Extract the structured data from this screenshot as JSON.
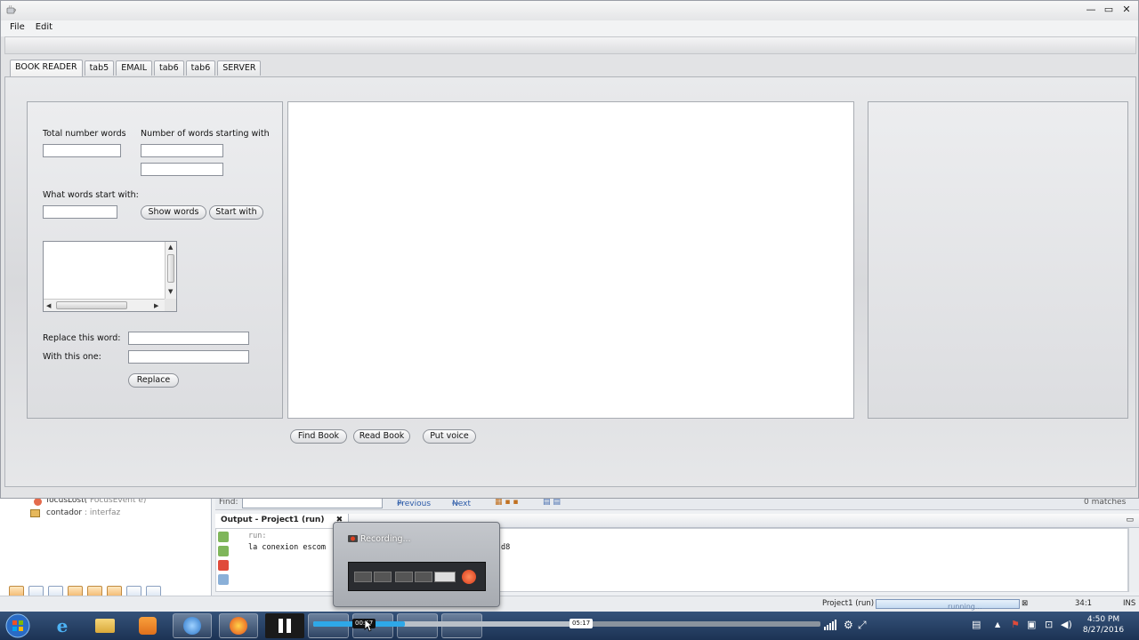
{
  "window": {
    "menu": [
      "File",
      "Edit"
    ],
    "tabs": [
      "BOOK READER",
      "tab5",
      "EMAIL",
      "tab6",
      "tab6",
      "SERVER"
    ],
    "active_tab": 0
  },
  "form": {
    "total_words_label": "Total number words",
    "words_starting_label": "Number of words starting with",
    "what_words_label": "What words start with:",
    "show_words_button": "Show words",
    "start_with_button": "Start with",
    "replace_word_label": "Replace this word:",
    "with_this_label": "With this one:",
    "replace_button": "Replace"
  },
  "actions": {
    "find_book": "Find Book",
    "read_book": "Read Book",
    "put_voice": "Put voice"
  },
  "ide": {
    "nav_items": [
      {
        "name": "focusLost(",
        "detail": "FocusEvent e)"
      },
      {
        "name": "contador",
        "detail": ": interfaz"
      }
    ],
    "find_label": "Find:",
    "previous": "Previous",
    "next": "Next",
    "matches": "0 matches",
    "output_tab": "Output - Project1 (run)",
    "output_lines": [
      "run:",
      "la conexion escom",
      "d8"
    ],
    "status_project": "Project1 (run)",
    "status_progress": "running...",
    "status_position": "34:1",
    "status_mode": "INS"
  },
  "recorder": {
    "title": "Recording..."
  },
  "video": {
    "current_time": "00:57",
    "total_time": "05:17",
    "played_fraction": 0.18,
    "buffered_fraction": 0.53
  },
  "clock": {
    "time": "4:50 PM",
    "date": "8/27/2016"
  },
  "colors": {
    "accent": "#2ea8e8",
    "record": "#d83a1a",
    "taskbar": "#1c3354"
  }
}
